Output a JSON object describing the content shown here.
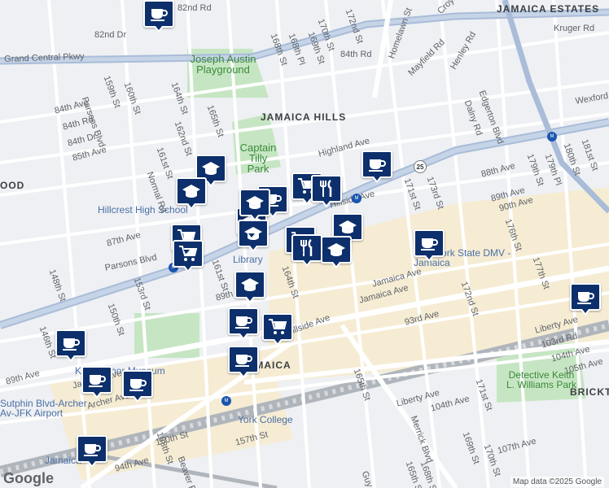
{
  "map": {
    "colors": {
      "background": "#eef0f3",
      "road": "#ffffff",
      "highway": "#a9bcd8",
      "park": "#c6e6c3",
      "commercial": "#f5ecd3",
      "marker": "#0d2f6b",
      "rail": "#b0b5bc"
    },
    "area_labels": [
      {
        "id": "jamaica-hills",
        "text": "JAMAICA HILLS"
      },
      {
        "id": "jamaica-estates",
        "text": "JAMAICA ESTATES"
      },
      {
        "id": "jamaica",
        "text": "JAMAICA"
      },
      {
        "id": "brickt",
        "text": "BRICKT"
      },
      {
        "id": "ood",
        "text": "OOD"
      }
    ],
    "park_labels": [
      {
        "id": "joseph-austin",
        "text": "Joseph Austin Playground"
      },
      {
        "id": "captain-tilly",
        "text": "Captain Tilly Park"
      },
      {
        "id": "keith-williams",
        "text": "Detective Keith L. Williams Park"
      }
    ],
    "poi_labels": [
      {
        "id": "hillcrest",
        "text": "Hillcrest High School"
      },
      {
        "id": "king-manor",
        "text": "King Manor Museum"
      },
      {
        "id": "york-college",
        "text": "York College"
      },
      {
        "id": "dmv",
        "text": "New York State DMV - Jamaica"
      },
      {
        "id": "library",
        "text": "Library"
      },
      {
        "id": "sutphin",
        "text": "Sutphin Blvd-Archer Av-JFK Airport"
      },
      {
        "id": "jamaica-stn",
        "text": "Jamaica"
      }
    ],
    "street_labels": [
      "82nd Rd",
      "82nd Dr",
      "Grand Central Pkwy",
      "Parsons Blvd",
      "159th St",
      "160th St",
      "164th St",
      "165th St",
      "168th St",
      "168th Pl",
      "169th St",
      "170th St",
      "172nd St",
      "84th Rd",
      "Homelawn St",
      "Croydon Rd",
      "Mayfield Rd",
      "Henley Rd",
      "Kruger Rd",
      "Edgerton Blvd",
      "Dalny Rd",
      "Wexford Ter",
      "179th St",
      "179th Pl",
      "180th St",
      "181st St",
      "84th Ave",
      "84th Rd",
      "84th Dr",
      "85th Ave",
      "161st St",
      "162nd St",
      "Normal Rd",
      "Highland Ave",
      "88th Ave",
      "89th Ave",
      "90th Ave",
      "173rd St",
      "176th St",
      "177th St",
      "171st St",
      "87th Ave",
      "Parsons Blvd",
      "148th St",
      "153rd St",
      "161st St",
      "164th St",
      "89th Ave",
      "Jamaica Ave",
      "Hillside Ave",
      "150th St",
      "146th St",
      "89th Ave",
      "Jamaica Ave",
      "93rd Ave",
      "Liberty Ave",
      "103rd Rd",
      "104th Ave",
      "105th Ave",
      "Archer Ave",
      "150th St",
      "158th St",
      "157th St",
      "Beaver Rd",
      "94th Ave",
      "165th St",
      "Merrick Blvd",
      "104th Ave",
      "169th St",
      "170th St",
      "171st St",
      "107th Ave",
      "Liberty Ave",
      "Guy R",
      "165th St",
      "168th St",
      "172nd St",
      "Hillside Ave",
      "Jamaica Ave"
    ],
    "highway_shield": "25",
    "metro_label": "M",
    "markers": [
      {
        "type": "cafe-icon"
      },
      {
        "type": "cafe-icon"
      },
      {
        "type": "school-icon"
      },
      {
        "type": "school-icon"
      },
      {
        "type": "shopping-cart-icon"
      },
      {
        "type": "restaurant-icon"
      },
      {
        "type": "school-icon"
      },
      {
        "type": "school-icon"
      },
      {
        "type": "shopping-cart-icon"
      },
      {
        "type": "cafe-icon"
      },
      {
        "type": "school-icon"
      },
      {
        "type": "shopping-cart-icon"
      },
      {
        "type": "restaurant-icon"
      },
      {
        "type": "school-icon"
      },
      {
        "type": "cafe-icon"
      },
      {
        "type": "school-icon"
      },
      {
        "type": "cafe-icon"
      },
      {
        "type": "shopping-cart-icon"
      },
      {
        "type": "cafe-icon"
      },
      {
        "type": "cafe-icon"
      },
      {
        "type": "cafe-icon"
      },
      {
        "type": "cafe-icon"
      },
      {
        "type": "cafe-icon"
      },
      {
        "type": "cafe-icon"
      },
      {
        "type": "shopping-cart-icon"
      },
      {
        "type": "school-icon"
      }
    ],
    "google_logo": "Google",
    "credit": "Map data ©2025 Google"
  }
}
